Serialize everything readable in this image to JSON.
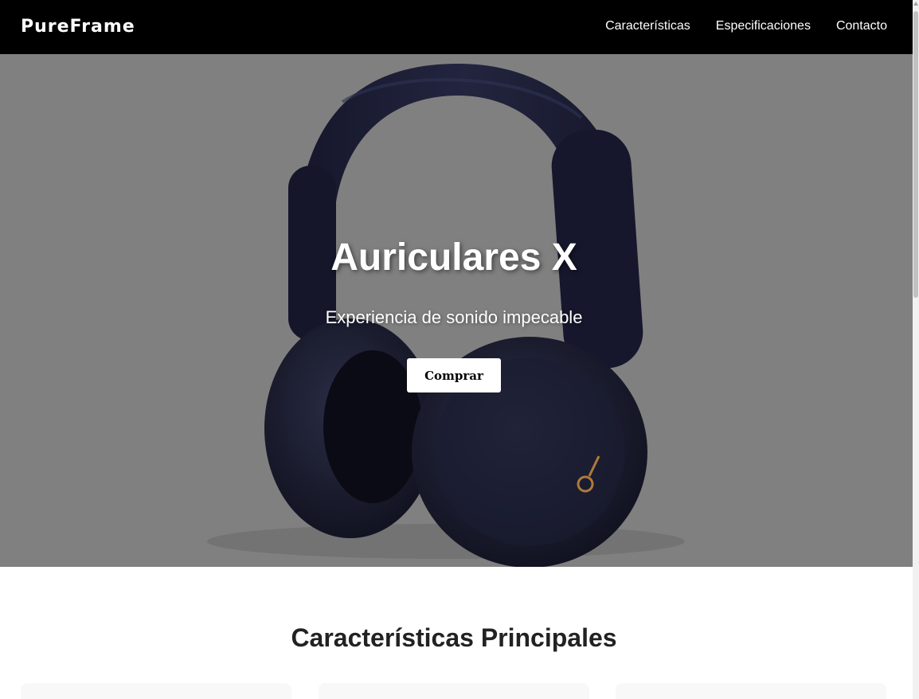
{
  "navbar": {
    "brand": "PureFrame",
    "links": [
      "Características",
      "Especificaciones",
      "Contacto"
    ],
    "background": "#000000"
  },
  "hero": {
    "title": "Auriculares X",
    "subtitle": "Experiencia de sonido impecable",
    "cta_label": "Comprar",
    "overlay_color": "#808080",
    "product_image": "headphones"
  },
  "features": {
    "title": "Características Principales"
  }
}
